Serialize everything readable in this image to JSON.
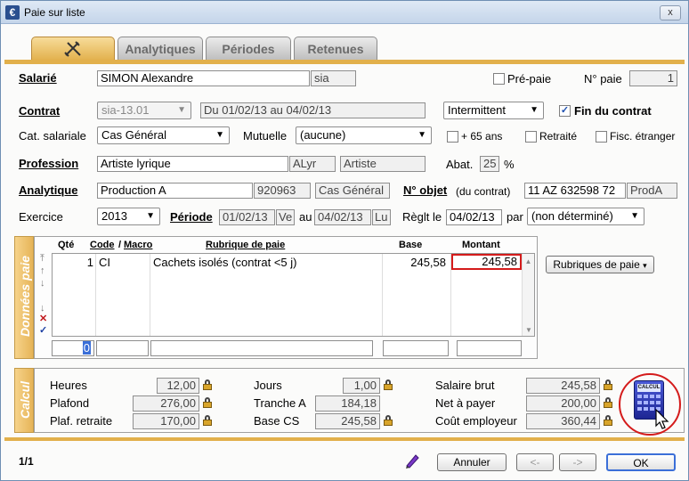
{
  "window": {
    "title": "Paie sur liste",
    "close": "x",
    "app_icon": "€"
  },
  "tabs": {
    "analytiques": "Analytiques",
    "periodes": "Périodes",
    "retenues": "Retenues"
  },
  "salarie": {
    "label": "Salarié",
    "name": "SIMON Alexandre",
    "code": "sia",
    "prepaie_label": "Pré-paie",
    "prepaie_checked": false,
    "npaie_label": "N° paie",
    "npaie": "1"
  },
  "contrat": {
    "label": "Contrat",
    "code": "sia-13.01",
    "dates": "Du 01/02/13 au 04/02/13",
    "type": "Intermittent",
    "fin_label": "Fin du contrat",
    "fin_checked": true
  },
  "cat": {
    "label": "Cat. salariale",
    "value": "Cas Général",
    "mutuelle_label": "Mutuelle",
    "mutuelle_value": "(aucune)",
    "plus65_label": "+ 65 ans",
    "retraite_label": "Retraité",
    "fisc_label": "Fisc. étranger"
  },
  "profession": {
    "label": "Profession",
    "value": "Artiste lyrique",
    "code": "ALyr",
    "category": "Artiste",
    "abat_label": "Abat.",
    "abat_value": "25",
    "abat_unit": "%"
  },
  "analytique": {
    "label": "Analytique",
    "value": "Production A",
    "code": "920963",
    "category": "Cas Général",
    "nobjet_label": "N° objet",
    "nobjet_sub": "(du contrat)",
    "nobjet_value": "11 AZ 632598 72",
    "nobjet_code": "ProdA"
  },
  "exercice": {
    "label": "Exercice",
    "value": "2013",
    "periode_label": "Période",
    "periode_from": "01/02/13",
    "periode_from_day": "Ve",
    "au_label": "au",
    "periode_to": "04/02/13",
    "periode_to_day": "Lu",
    "reglt_label": "Règlt le",
    "reglt_date": "04/02/13",
    "par_label": "par",
    "par_value": "(non déterminé)"
  },
  "donnees": {
    "side_label": "Données paie",
    "headers": {
      "qte": "Qté",
      "code": "Code",
      "sep": "/",
      "macro": "Macro",
      "rubrique": "Rubrique de paie",
      "base": "Base",
      "montant": "Montant"
    },
    "rows": [
      {
        "qte": "1",
        "code": "CI",
        "rubrique": "Cachets isolés (contrat <5 j)",
        "base": "245,58",
        "montant": "245,58"
      }
    ],
    "entry": {
      "qte": "0"
    },
    "rubriques_button": "Rubriques de paie"
  },
  "calcul": {
    "side_label": "Calcul",
    "heures_label": "Heures",
    "heures": "12,00",
    "plafond_label": "Plafond",
    "plafond": "276,00",
    "plafretraite_label": "Plaf. retraite",
    "plafretraite": "170,00",
    "jours_label": "Jours",
    "jours": "1,00",
    "tranchea_label": "Tranche A",
    "tranchea": "184,18",
    "basecs_label": "Base CS",
    "basecs": "245,58",
    "brut_label": "Salaire brut",
    "brut": "245,58",
    "net_label": "Net à payer",
    "net": "200,00",
    "cout_label": "Coût employeur",
    "cout": "360,44",
    "calc_icon_text": "CALCUL"
  },
  "footer": {
    "page": "1/1",
    "annuler": "Annuler",
    "prev": "<-",
    "next": "->",
    "ok": "OK"
  }
}
